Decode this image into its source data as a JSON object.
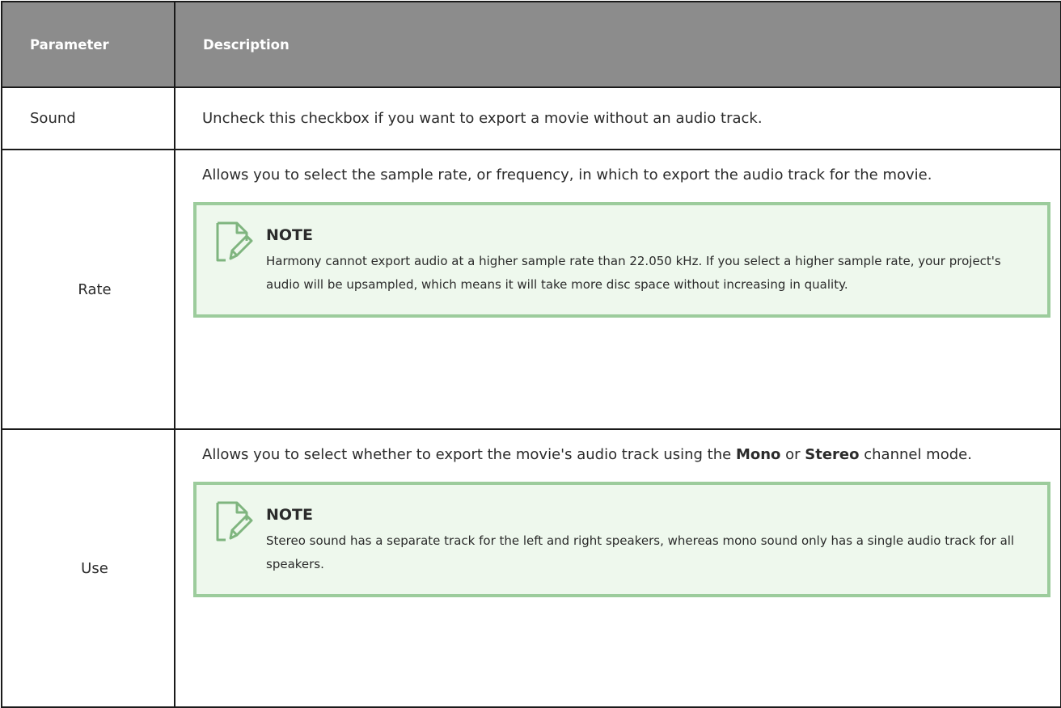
{
  "header": {
    "parameter": "Parameter",
    "description": "Description"
  },
  "rows": [
    {
      "parameter": "Sound",
      "description": "Uncheck this checkbox if you want to export a movie without an audio track."
    },
    {
      "parameter": "Rate",
      "description": "Allows you to select the sample rate, or frequency, in which to export the audio track for the movie.",
      "note": {
        "title": "NOTE",
        "body": "Harmony cannot export audio at a higher sample rate than 22.050 kHz. If you select a higher sample rate, your project's audio will be upsampled, which means it will take more disc space without increasing in quality."
      }
    },
    {
      "parameter": "Use",
      "description_pre": "Allows you to select whether to export the movie's audio track using the ",
      "description_bold1": "Mono",
      "description_mid": " or ",
      "description_bold2": "Stereo",
      "description_post": " channel mode.",
      "note": {
        "title": "NOTE",
        "body": "Stereo sound has a separate track for the left and right speakers, whereas mono sound only has a single audio track for all speakers."
      }
    }
  ],
  "colors": {
    "header_bg": "#8c8c8c",
    "note_bg": "#eef8ed",
    "note_border": "#9ccc9c",
    "note_icon": "#7fb57f"
  },
  "icons": {
    "note": "note-edit-icon"
  }
}
